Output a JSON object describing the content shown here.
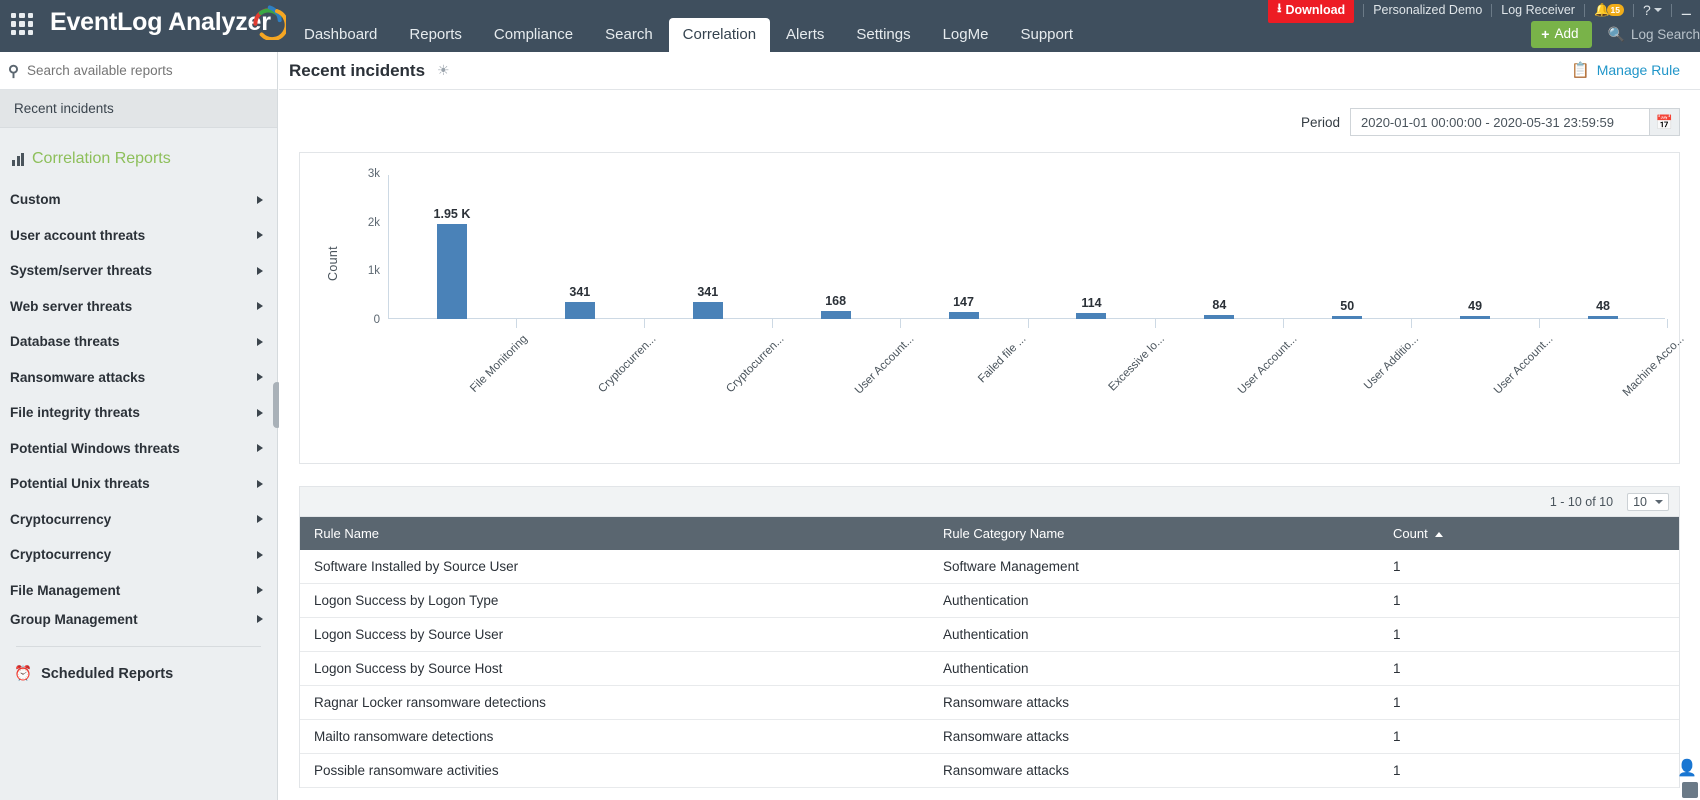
{
  "header": {
    "brand": "EventLog Analyzer",
    "grid_icon": "apps-grid-icon",
    "nav": [
      {
        "label": "Dashboard",
        "active": false
      },
      {
        "label": "Reports",
        "active": false
      },
      {
        "label": "Compliance",
        "active": false
      },
      {
        "label": "Search",
        "active": false
      },
      {
        "label": "Correlation",
        "active": true
      },
      {
        "label": "Alerts",
        "active": false
      },
      {
        "label": "Settings",
        "active": false
      },
      {
        "label": "LogMe",
        "active": false
      },
      {
        "label": "Support",
        "active": false
      }
    ],
    "utility": {
      "download": "Download",
      "personalized_demo": "Personalized Demo",
      "log_receiver": "Log Receiver",
      "notification_count": "15",
      "help": "?"
    },
    "add_button": "Add",
    "search_placeholder": "Log Search",
    "accent_green": "#79b349",
    "accent_red": "#ed1c24",
    "bar_dark": "#3f4f5e"
  },
  "sidebar": {
    "search_placeholder": "Search available reports",
    "recent": "Recent incidents",
    "section_title": "Correlation Reports",
    "items": [
      {
        "label": "Custom"
      },
      {
        "label": "User account threats"
      },
      {
        "label": "System/server threats"
      },
      {
        "label": "Web server threats"
      },
      {
        "label": "Database threats"
      },
      {
        "label": "Ransomware attacks"
      },
      {
        "label": "File integrity threats"
      },
      {
        "label": "Potential Windows threats"
      },
      {
        "label": "Potential Unix threats"
      },
      {
        "label": "Cryptocurrency"
      },
      {
        "label": "Cryptocurrency"
      },
      {
        "label": "File Management"
      },
      {
        "label": "Group Management"
      }
    ],
    "scheduled_reports": "Scheduled Reports"
  },
  "main": {
    "page_title": "Recent incidents",
    "manage_rule": "Manage Rule",
    "period_label": "Period",
    "period_value": "2020-01-01 00:00:00 - 2020-05-31 23:59:59"
  },
  "chart_data": {
    "type": "bar",
    "title": "",
    "xlabel": "",
    "ylabel": "Count",
    "ylim": [
      0,
      3000
    ],
    "yticks": [
      "0",
      "1k",
      "2k",
      "3k"
    ],
    "ytick_values": [
      0,
      1000,
      2000,
      3000
    ],
    "grid": false,
    "legend": "none",
    "bar_color": "#4a82b8",
    "categories": [
      "File Monitoring",
      "Cryptocurren...",
      "Cryptocurren...",
      "User Account...",
      "Failed file ...",
      "Excessive lo...",
      "User Account...",
      "User Additio...",
      "User Account...",
      "Machine Acco..."
    ],
    "values": [
      1950,
      341,
      341,
      168,
      147,
      114,
      84,
      50,
      49,
      48
    ],
    "value_labels": [
      "1.95 K",
      "341",
      "341",
      "168",
      "147",
      "114",
      "84",
      "50",
      "49",
      "48"
    ]
  },
  "table": {
    "range_text": "1 - 10 of 10",
    "page_size": "10",
    "columns": [
      "Rule Name",
      "Rule Category Name",
      "Count"
    ],
    "sort_column": "Count",
    "sort_direction": "asc",
    "rows": [
      {
        "rule": "Software Installed by Source User",
        "category": "Software Management",
        "count": "1"
      },
      {
        "rule": "Logon Success by Logon Type",
        "category": "Authentication",
        "count": "1"
      },
      {
        "rule": "Logon Success by Source User",
        "category": "Authentication",
        "count": "1"
      },
      {
        "rule": "Logon Success by Source Host",
        "category": "Authentication",
        "count": "1"
      },
      {
        "rule": "Ragnar Locker ransomware detections",
        "category": "Ransomware attacks",
        "count": "1"
      },
      {
        "rule": "Mailto ransomware detections",
        "category": "Ransomware attacks",
        "count": "1"
      },
      {
        "rule": "Possible ransomware activities",
        "category": "Ransomware attacks",
        "count": "1"
      }
    ]
  }
}
